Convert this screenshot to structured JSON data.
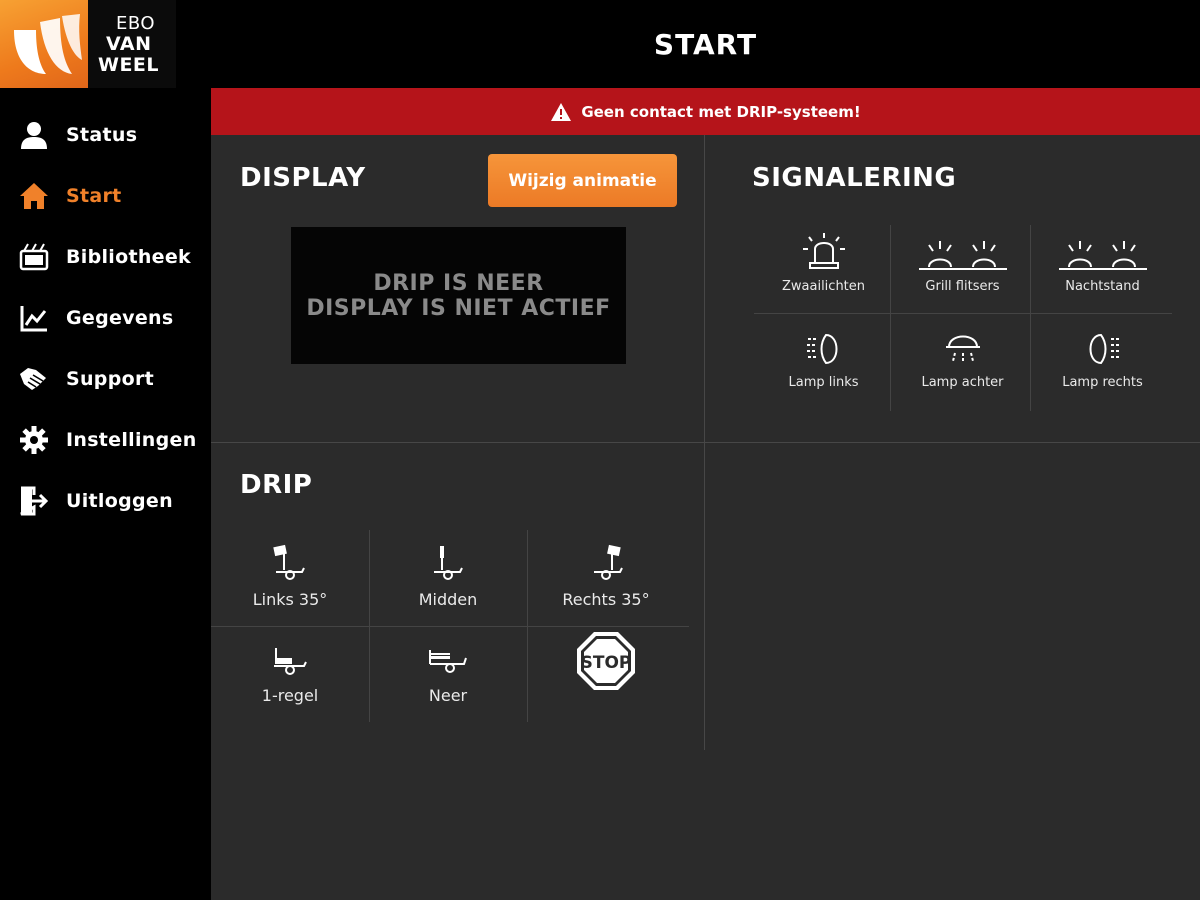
{
  "brand": {
    "line1": "EBO",
    "line2": "VAN",
    "line3": "WEEL"
  },
  "header": {
    "title": "START"
  },
  "alert": {
    "text": "Geen contact met DRIP-systeem!"
  },
  "sidebar": {
    "items": [
      {
        "label": "Status",
        "icon": "user-icon",
        "active": false
      },
      {
        "label": "Start",
        "icon": "home-icon",
        "active": true
      },
      {
        "label": "Bibliotheek",
        "icon": "library-icon",
        "active": false
      },
      {
        "label": "Gegevens",
        "icon": "chart-icon",
        "active": false
      },
      {
        "label": "Support",
        "icon": "handshake-icon",
        "active": false
      },
      {
        "label": "Instellingen",
        "icon": "gear-icon",
        "active": false
      },
      {
        "label": "Uitloggen",
        "icon": "logout-icon",
        "active": false
      }
    ]
  },
  "display": {
    "title": "DISPLAY",
    "button_label": "Wijzig animatie",
    "screen_line1": "DRIP IS NEER",
    "screen_line2": "DISPLAY IS NIET ACTIEF"
  },
  "signalering": {
    "title": "SIGNALERING",
    "items": [
      {
        "label": "Zwaailichten",
        "icon": "beacon-icon"
      },
      {
        "label": "Grill flitsers",
        "icon": "grill-flash-icon"
      },
      {
        "label": "Nachtstand",
        "icon": "night-mode-icon"
      },
      {
        "label": "Lamp links",
        "icon": "lamp-left-icon"
      },
      {
        "label": "Lamp achter",
        "icon": "lamp-rear-icon"
      },
      {
        "label": "Lamp rechts",
        "icon": "lamp-right-icon"
      }
    ]
  },
  "drip": {
    "title": "DRIP",
    "items": [
      {
        "label": "Links 35°",
        "icon": "drip-left-icon"
      },
      {
        "label": "Midden",
        "icon": "drip-middle-icon"
      },
      {
        "label": "Rechts 35°",
        "icon": "drip-right-icon"
      },
      {
        "label": "1-regel",
        "icon": "drip-one-line-icon"
      },
      {
        "label": "Neer",
        "icon": "drip-down-icon"
      },
      {
        "label": "STOP",
        "icon": "stop-sign-icon"
      }
    ]
  },
  "colors": {
    "accent": "#f0812a",
    "alert": "#b5141a",
    "panel": "#2b2b2b"
  }
}
